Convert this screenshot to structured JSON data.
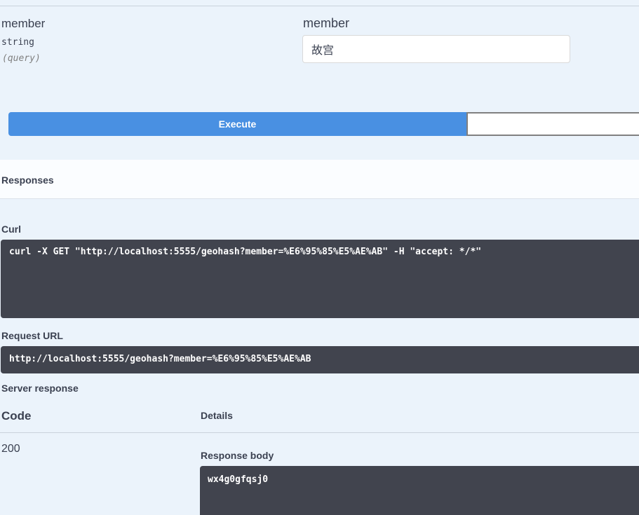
{
  "parameter": {
    "name": "member",
    "type": "string",
    "in": "(query)",
    "field_label": "member",
    "value": "故宫"
  },
  "buttons": {
    "execute": "Execute",
    "clear": ""
  },
  "responses": {
    "title": "Responses",
    "curl_label": "Curl",
    "curl_command": "curl -X GET \"http://localhost:5555/geohash?member=%E6%95%85%E5%AE%AB\" -H \"accept: */*\"",
    "request_url_label": "Request URL",
    "request_url": "http://localhost:5555/geohash?member=%E6%95%85%E5%AE%AB",
    "server_response_label": "Server response",
    "table": {
      "code_header": "Code",
      "details_header": "Details"
    },
    "row": {
      "code": "200",
      "body_label": "Response body",
      "body": "wx4g0gfqsj0"
    }
  }
}
